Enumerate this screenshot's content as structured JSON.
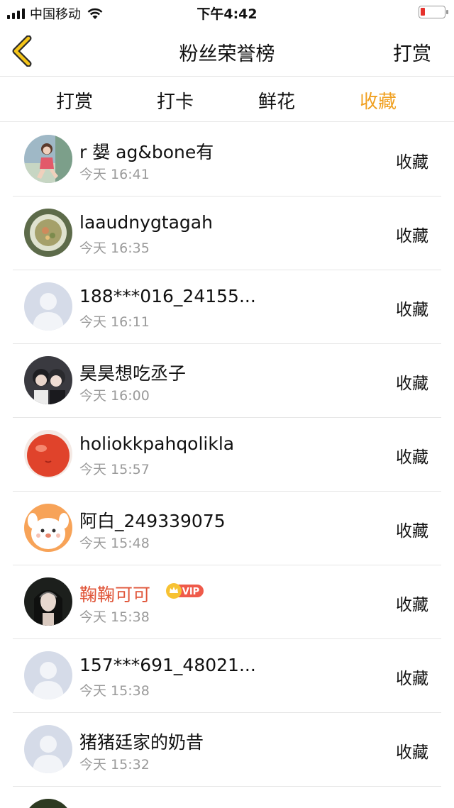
{
  "status_bar": {
    "carrier": "中国移动",
    "time": "下午4:42",
    "battery_color": "#e5312c"
  },
  "nav": {
    "title": "粉丝荣誉榜",
    "action": "打赏",
    "back_icon": "chevron-left-icon"
  },
  "tabs": [
    {
      "label": "打赏",
      "active": false
    },
    {
      "label": "打卡",
      "active": false
    },
    {
      "label": "鲜花",
      "active": false
    },
    {
      "label": "收藏",
      "active": true
    }
  ],
  "accent_color": "#f0a020",
  "items": [
    {
      "name": "r 嫢 ag&bone有",
      "time": "今天 16:41",
      "action": "收藏",
      "avatar": "photo-girl"
    },
    {
      "name": "laaudnygtagah",
      "time": "今天 16:35",
      "action": "收藏",
      "avatar": "photo-food"
    },
    {
      "name": "188***016_24155...",
      "time": "今天 16:11",
      "action": "收藏",
      "avatar": "default"
    },
    {
      "name": "昊昊想吃丞子",
      "time": "今天 16:00",
      "action": "收藏",
      "avatar": "photo-couple"
    },
    {
      "name": "holiokkpahqolikla",
      "time": "今天 15:57",
      "action": "收藏",
      "avatar": "tomato"
    },
    {
      "name": "阿白_249339075",
      "time": "今天 15:48",
      "action": "收藏",
      "avatar": "cartoon-dog"
    },
    {
      "name": "鞠鞠可可",
      "time": "今天 15:38",
      "action": "收藏",
      "avatar": "photo-portrait",
      "vip": "VIP"
    },
    {
      "name": "157***691_48021...",
      "time": "今天 15:38",
      "action": "收藏",
      "avatar": "default"
    },
    {
      "name": "猪猪廷家的奶昔",
      "time": "今天 15:32",
      "action": "收藏",
      "avatar": "default"
    }
  ]
}
